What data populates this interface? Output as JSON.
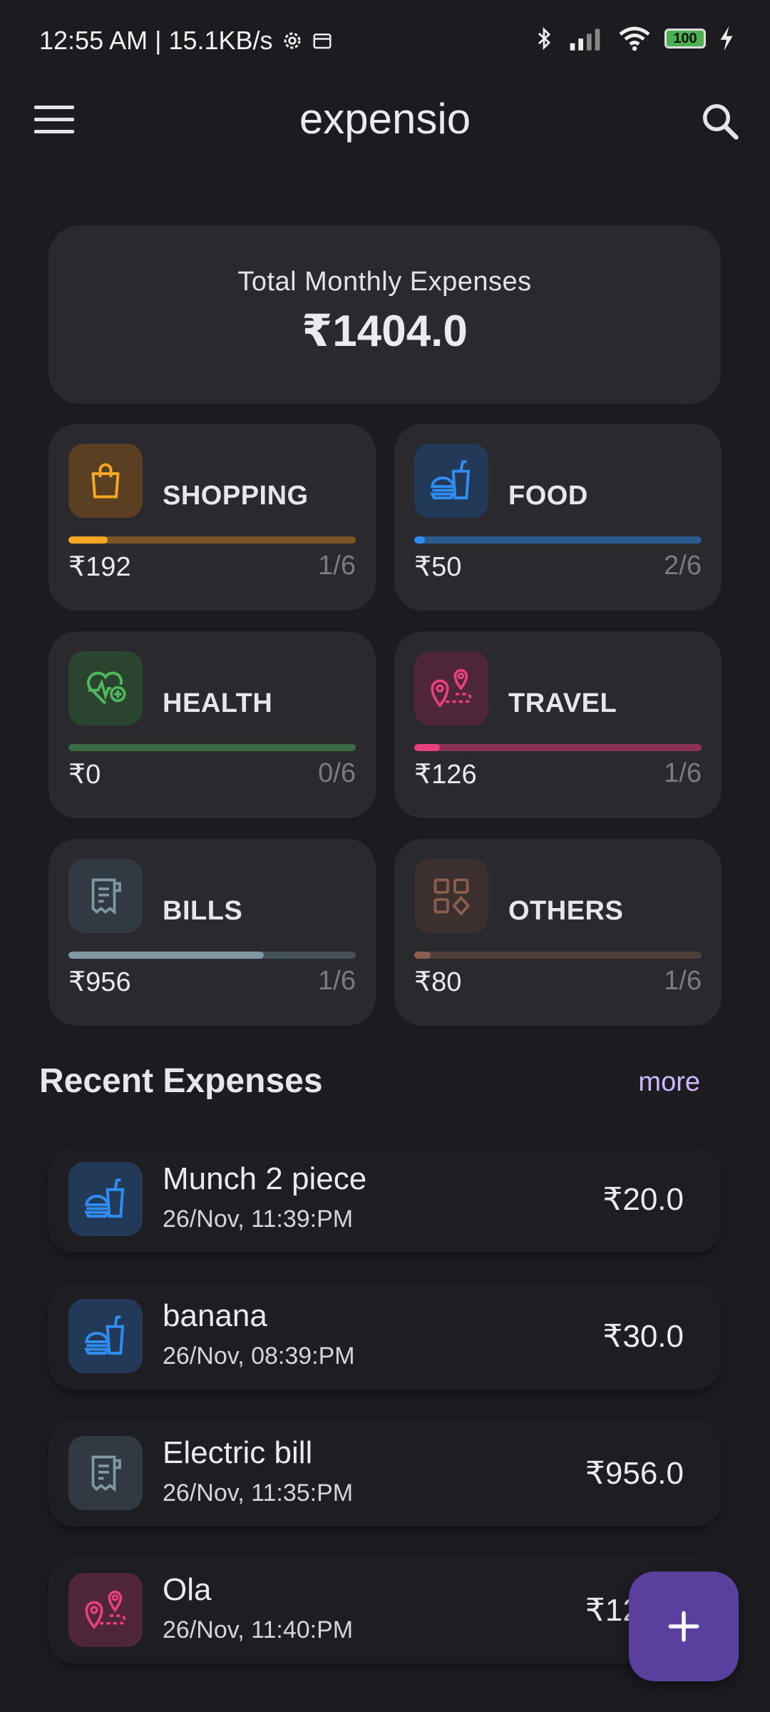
{
  "status_bar": {
    "time_speed": "12:55 AM | 15.1KB/s",
    "battery_level": "100"
  },
  "app_bar": {
    "title": "expensio"
  },
  "summary": {
    "label": "Total Monthly Expenses",
    "value": "₹1404.0"
  },
  "categories": [
    {
      "name": "SHOPPING",
      "amount": "₹192",
      "count": "1/6",
      "icon": "shopping-bag-icon",
      "color": "#f5a623",
      "tile_bg": "#5a3f22",
      "track": "#7a5526",
      "progress": 0.137
    },
    {
      "name": "FOOD",
      "amount": "₹50",
      "count": "2/6",
      "icon": "fast-food-icon",
      "color": "#2f8cf0",
      "tile_bg": "#223a57",
      "track": "#2a5b8f",
      "progress": 0.036
    },
    {
      "name": "HEALTH",
      "amount": "₹0",
      "count": "0/6",
      "icon": "heart-health-icon",
      "color": "#4fb85c",
      "tile_bg": "#2b4430",
      "track": "#3b6b41",
      "progress": 0.0
    },
    {
      "name": "TRAVEL",
      "amount": "₹126",
      "count": "1/6",
      "icon": "map-pin-travel-icon",
      "color": "#ea3f7d",
      "tile_bg": "#4e2638",
      "track": "#8a2f55",
      "progress": 0.09
    },
    {
      "name": "BILLS",
      "amount": "₹956",
      "count": "1/6",
      "icon": "receipt-icon",
      "color": "#7f98a4",
      "tile_bg": "#313a42",
      "track": "#45525a",
      "progress": 0.68
    },
    {
      "name": "OTHERS",
      "amount": "₹80",
      "count": "1/6",
      "icon": "grid-shapes-icon",
      "color": "#8a5f4f",
      "tile_bg": "#3b302e",
      "track": "#4f3e38",
      "progress": 0.057
    }
  ],
  "recent": {
    "title": "Recent Expenses",
    "more_label": "more",
    "items": [
      {
        "title": "Munch 2 piece",
        "date": "26/Nov, 11:39:PM",
        "amount": "₹20.0",
        "category": "FOOD"
      },
      {
        "title": "banana",
        "date": "26/Nov, 08:39:PM",
        "amount": "₹30.0",
        "category": "FOOD"
      },
      {
        "title": "Electric bill",
        "date": "26/Nov, 11:35:PM",
        "amount": "₹956.0",
        "category": "BILLS"
      },
      {
        "title": "Ola",
        "date": "26/Nov, 11:40:PM",
        "amount": "₹126.0",
        "category": "TRAVEL"
      }
    ]
  },
  "fab": {
    "icon": "plus-icon",
    "color": "#5b3f9e"
  }
}
